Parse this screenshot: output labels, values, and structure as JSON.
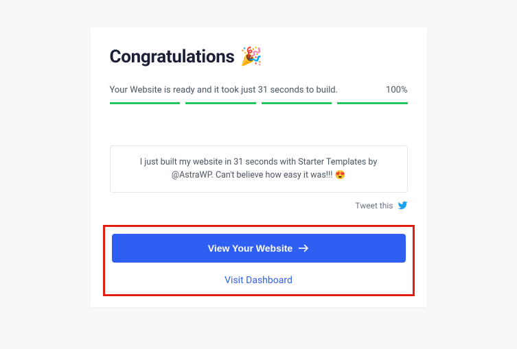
{
  "title": "Congratulations",
  "party_icon": "🎉",
  "status_text": "Your Website is ready and it took just 31 seconds to build.",
  "progress_percent": "100%",
  "tweet_message": "I just built my website in 31 seconds with Starter Templates by @AstraWP. Can't believe how easy it was!!!",
  "heart_emoji": "😍",
  "tweet_link_label": "Tweet this",
  "primary_button_label": "View Your Website",
  "secondary_link_label": "Visit Dashboard"
}
